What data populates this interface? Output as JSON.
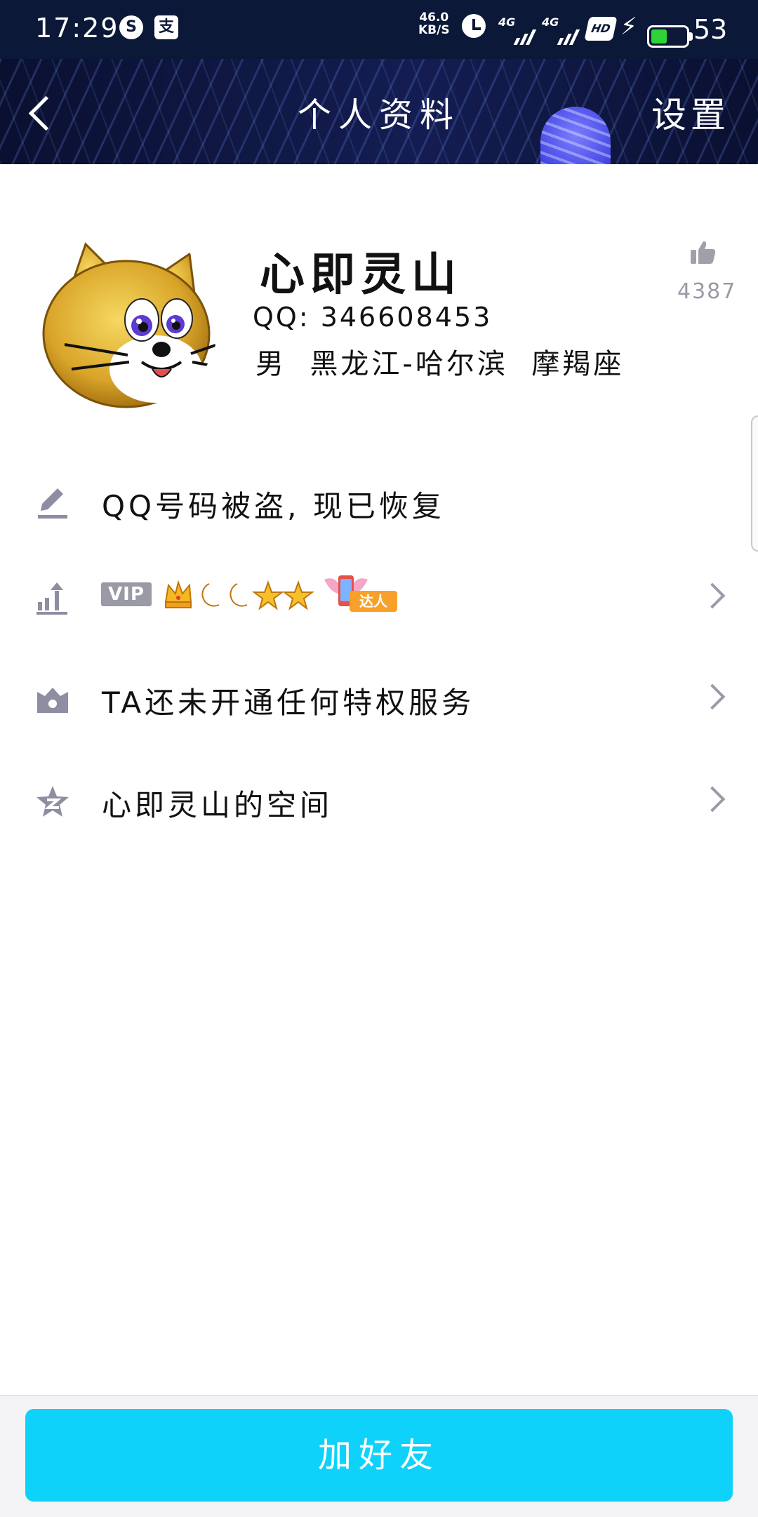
{
  "status_bar": {
    "time": "17:29",
    "app_icon_1": "S",
    "app_icon_2": "支",
    "net_speed_value": "46.0",
    "net_speed_unit": "KB/S",
    "signal_1": "4G",
    "signal_2": "4G",
    "hd_label": "HD",
    "battery_level": "53",
    "battery_fraction": 0.53,
    "battery_color": "#2ed33a"
  },
  "header": {
    "title": "个人资料",
    "settings_label": "设置"
  },
  "profile": {
    "name": "心即灵山",
    "qq_line": "QQ: 346608453",
    "gender": "男",
    "location": "黑龙江-哈尔滨",
    "zodiac": "摩羯座",
    "like_count": "4387"
  },
  "rows": {
    "signature": "QQ号码被盗, 现已恢复",
    "vip_label": "VIP",
    "vip_daren_tag": "达人",
    "privilege": "TA还未开通任何特权服务",
    "space": "心即灵山的空间"
  },
  "footer": {
    "add_friend_label": "加好友",
    "accent_color": "#0fd2fb"
  }
}
